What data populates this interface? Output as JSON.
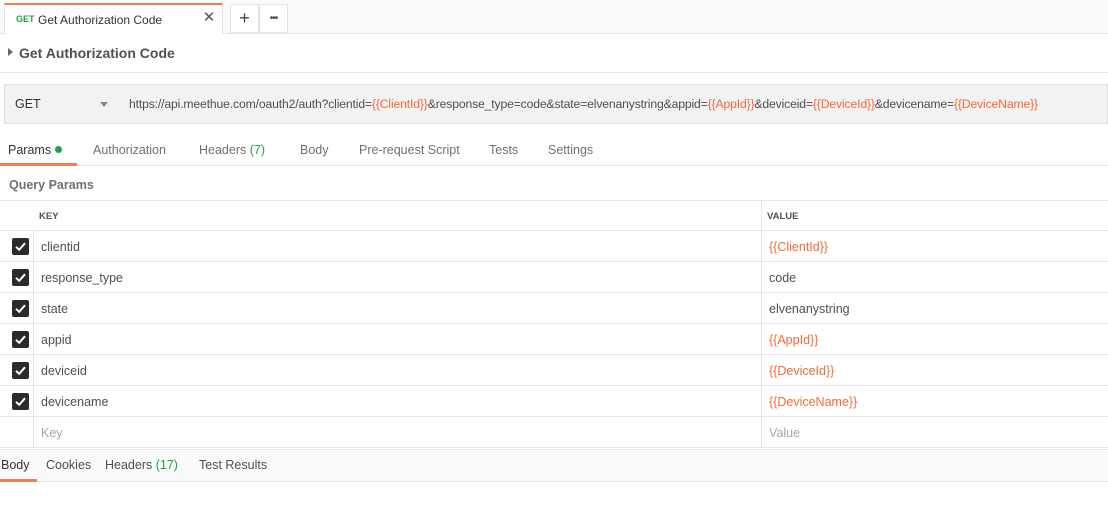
{
  "tab": {
    "method": "GET",
    "title": "Get Authorization Code",
    "close_glyph": "✕",
    "new_glyph": "+",
    "more_glyph": "•••"
  },
  "request": {
    "name": "Get Authorization Code"
  },
  "url_bar": {
    "method": "GET",
    "segments": [
      {
        "text": "https://api.meethue.com/oauth2/auth?clientid=",
        "var": false
      },
      {
        "text": "{{ClientId}}",
        "var": true
      },
      {
        "text": "&response_type=code&state=elvenanystring&appid=",
        "var": false
      },
      {
        "text": "{{AppId}}",
        "var": true
      },
      {
        "text": "&deviceid=",
        "var": false
      },
      {
        "text": "{{DeviceId}}",
        "var": true
      },
      {
        "text": "&devicename=",
        "var": false
      },
      {
        "text": "{{DeviceName}}",
        "var": true
      }
    ]
  },
  "request_tabs": {
    "params": "Params",
    "authorization": "Authorization",
    "headers": "Headers",
    "headers_count": "(7)",
    "body": "Body",
    "prerequest": "Pre-request Script",
    "tests": "Tests",
    "settings": "Settings"
  },
  "query_params": {
    "title": "Query Params",
    "key_header": "KEY",
    "value_header": "VALUE",
    "rows": [
      {
        "key": "clientid",
        "value": "{{ClientId}}",
        "is_var": true
      },
      {
        "key": "response_type",
        "value": "code",
        "is_var": false
      },
      {
        "key": "state",
        "value": "elvenanystring",
        "is_var": false
      },
      {
        "key": "appid",
        "value": "{{AppId}}",
        "is_var": true
      },
      {
        "key": "deviceid",
        "value": "{{DeviceId}}",
        "is_var": true
      },
      {
        "key": "devicename",
        "value": "{{DeviceName}}",
        "is_var": true
      }
    ],
    "key_placeholder": "Key",
    "value_placeholder": "Value"
  },
  "response_tabs": {
    "body": "Body",
    "cookies": "Cookies",
    "headers": "Headers",
    "headers_count": "(17)",
    "test_results": "Test Results"
  },
  "colors": {
    "accent": "#f07d54",
    "variable": "#f26b3a",
    "method_green": "#20a14b"
  }
}
